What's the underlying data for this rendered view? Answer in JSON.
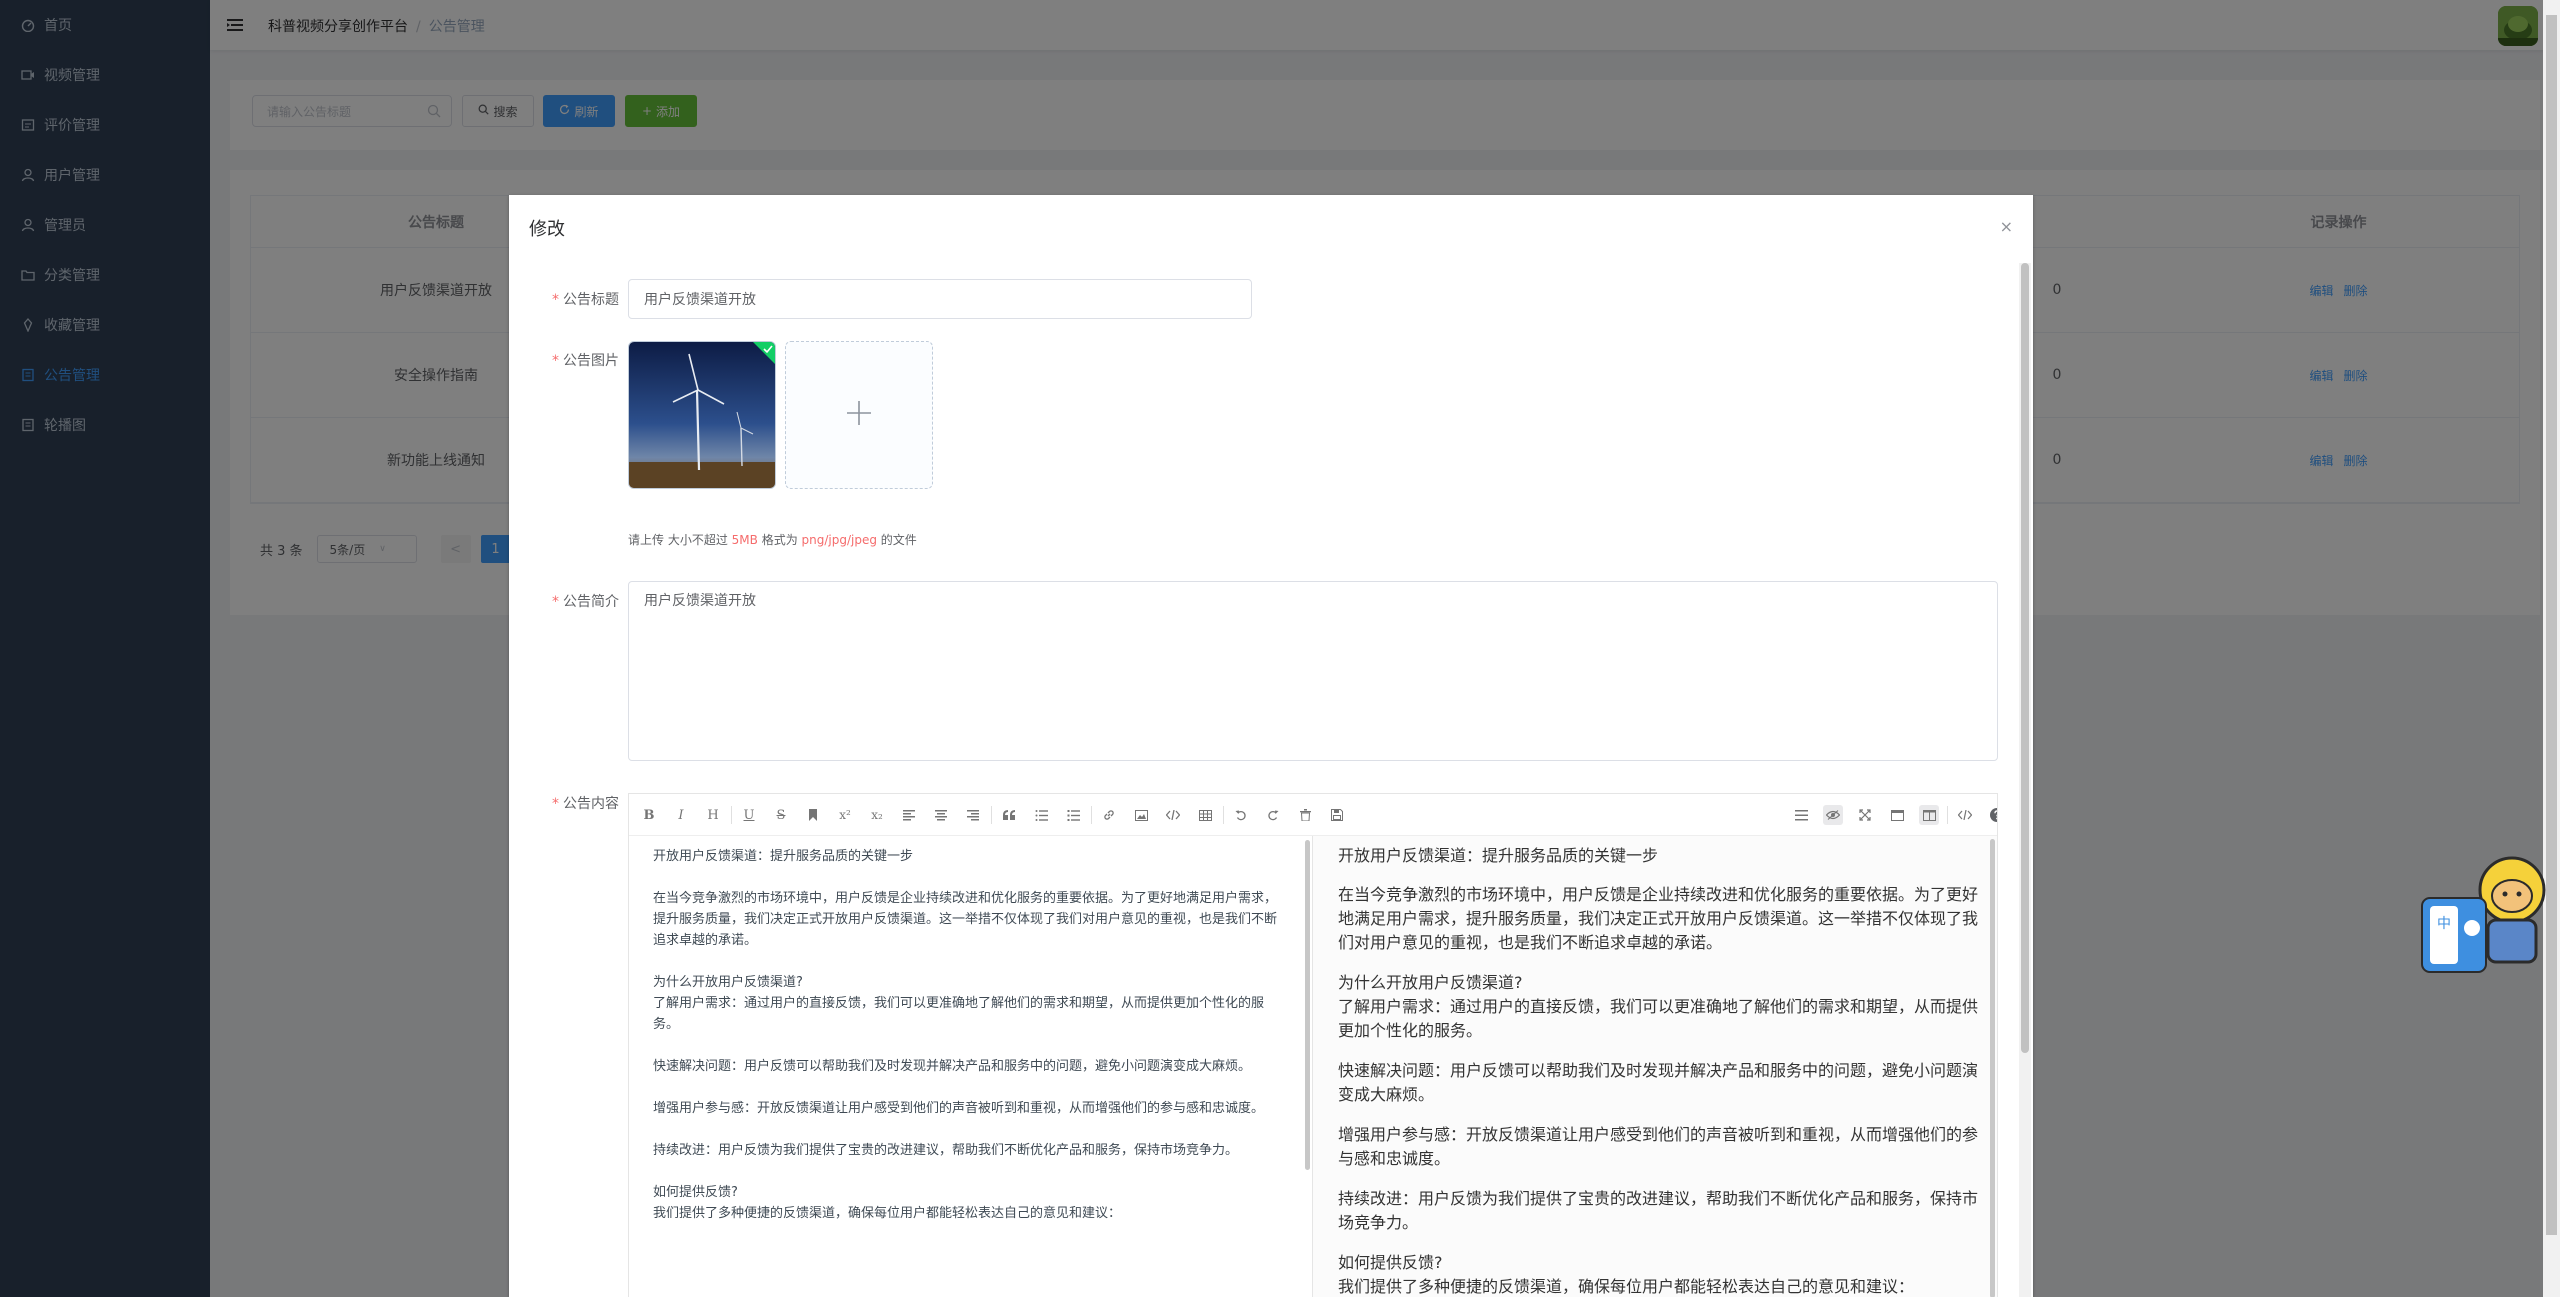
{
  "sidebar": {
    "items": [
      {
        "label": "首页",
        "icon": "dashboard-icon"
      },
      {
        "label": "视频管理",
        "icon": "video-icon"
      },
      {
        "label": "评价管理",
        "icon": "comment-icon"
      },
      {
        "label": "用户管理",
        "icon": "user-icon"
      },
      {
        "label": "管理员",
        "icon": "admin-icon"
      },
      {
        "label": "分类管理",
        "icon": "folder-icon"
      },
      {
        "label": "收藏管理",
        "icon": "favorite-icon"
      },
      {
        "label": "公告管理",
        "icon": "notice-icon"
      },
      {
        "label": "轮播图",
        "icon": "carousel-icon"
      }
    ],
    "active_index": 7,
    "active_color": "#409eff"
  },
  "header": {
    "breadcrumb": [
      "科普视频分享创作平台",
      "公告管理"
    ]
  },
  "search": {
    "placeholder": "请输入公告标题",
    "search_label": "搜索",
    "refresh_label": "刷新",
    "add_label": "添加"
  },
  "table": {
    "columns": [
      "公告标题",
      "记录操作"
    ],
    "rows": [
      {
        "title": "用户反馈渠道开放",
        "edit": "编辑",
        "delete": "删除"
      },
      {
        "title": "安全操作指南",
        "edit": "编辑",
        "delete": "删除"
      },
      {
        "title": "新功能上线通知",
        "edit": "编辑",
        "delete": "删除"
      }
    ],
    "edge_values": [
      "0",
      "0",
      "0"
    ]
  },
  "pagination": {
    "total": "共 3 条",
    "page_size": "5条/页",
    "prev": "<",
    "current": "1"
  },
  "dialog": {
    "title": "修改",
    "close": "×",
    "fields": {
      "title_label": "公告标题",
      "title_value": "用户反馈渠道开放",
      "image_label": "公告图片",
      "upload_tip_prefix": "请上传 大小不超过 ",
      "upload_tip_size": "5MB",
      "upload_tip_middle": " 格式为 ",
      "upload_tip_formats": "png/jpg/jpeg",
      "upload_tip_suffix": " 的文件",
      "intro_label": "公告简介",
      "intro_value": "用户反馈渠道开放",
      "content_label": "公告内容"
    }
  },
  "editor": {
    "toolbar_left": [
      "B",
      "I",
      "H",
      "U",
      "S",
      "bookmark-icon",
      "x²",
      "x₂",
      "align-left-icon",
      "align-center-icon",
      "align-right-icon",
      "quote-icon",
      "ordered-list-icon",
      "unordered-list-icon",
      "link-icon",
      "image-icon",
      "code-icon",
      "table-icon",
      "undo-icon",
      "redo-icon",
      "trash-icon",
      "save-icon"
    ],
    "toolbar_right": [
      "navigation-icon",
      "preview-icon",
      "fullscreen-icon",
      "html-preview-icon",
      "subfield-icon",
      "source-icon",
      "help-icon"
    ],
    "markdown": "开放用户反馈渠道：提升服务品质的关键一步\n\n在当今竞争激烈的市场环境中，用户反馈是企业持续改进和优化服务的重要依据。为了更好地满足用户需求，提升服务质量，我们决定正式开放用户反馈渠道。这一举措不仅体现了我们对用户意见的重视，也是我们不断追求卓越的承诺。\n\n为什么开放用户反馈渠道?\n了解用户需求：通过用户的直接反馈，我们可以更准确地了解他们的需求和期望，从而提供更加个性化的服务。\n\n快速解决问题：用户反馈可以帮助我们及时发现并解决产品和服务中的问题，避免小问题演变成大麻烦。\n\n增强用户参与感：开放反馈渠道让用户感受到他们的声音被听到和重视，从而增强他们的参与感和忠诚度。\n\n持续改进：用户反馈为我们提供了宝贵的改进建议，帮助我们不断优化产品和服务，保持市场竞争力。\n\n如何提供反馈?\n我们提供了多种便捷的反馈渠道，确保每位用户都能轻松表达自己的意见和建议：",
    "preview": [
      "开放用户反馈渠道：提升服务品质的关键一步",
      "在当今竞争激烈的市场环境中，用户反馈是企业持续改进和优化服务的重要依据。为了更好地满足用户需求，提升服务质量，我们决定正式开放用户反馈渠道。这一举措不仅体现了我们对用户意见的重视，也是我们不断追求卓越的承诺。",
      "为什么开放用户反馈渠道?\n了解用户需求：通过用户的直接反馈，我们可以更准确地了解他们的需求和期望，从而提供更加个性化的服务。",
      "快速解决问题：用户反馈可以帮助我们及时发现并解决产品和服务中的问题，避免小问题演变成大麻烦。",
      "增强用户参与感：开放反馈渠道让用户感受到他们的声音被听到和重视，从而增强他们的参与感和忠诚度。",
      "持续改进：用户反馈为我们提供了宝贵的改进建议，帮助我们不断优化产品和服务，保持市场竞争力。",
      "如何提供反馈?\n我们提供了多种便捷的反馈渠道，确保每位用户都能轻松表达自己的意见和建议："
    ]
  },
  "mascot": {
    "badge_text": "中"
  }
}
